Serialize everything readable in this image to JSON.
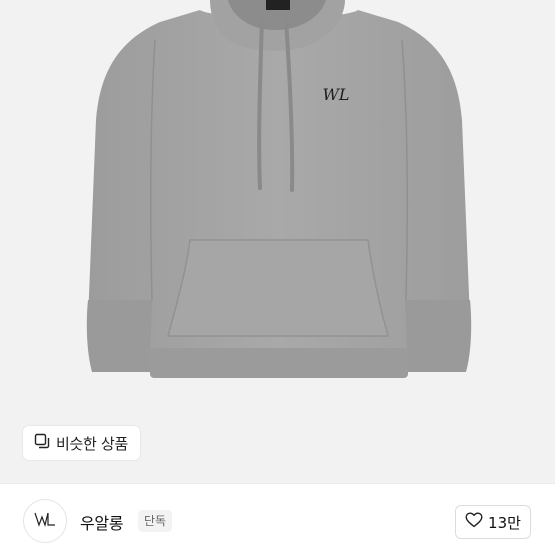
{
  "product_image": {
    "alt": "hoodie-photo"
  },
  "similar_products": {
    "label": "비슷한 상품",
    "icon": "similar-items-icon"
  },
  "seller": {
    "name": "우알롱",
    "badge": "단독",
    "avatar_icon": "wooalong-logo-icon"
  },
  "like": {
    "count": "13만",
    "icon": "heart-outline-icon"
  },
  "colors": {
    "hoodie": "#a4a4a4",
    "background": "#f2f2f2",
    "text": "#111111"
  }
}
